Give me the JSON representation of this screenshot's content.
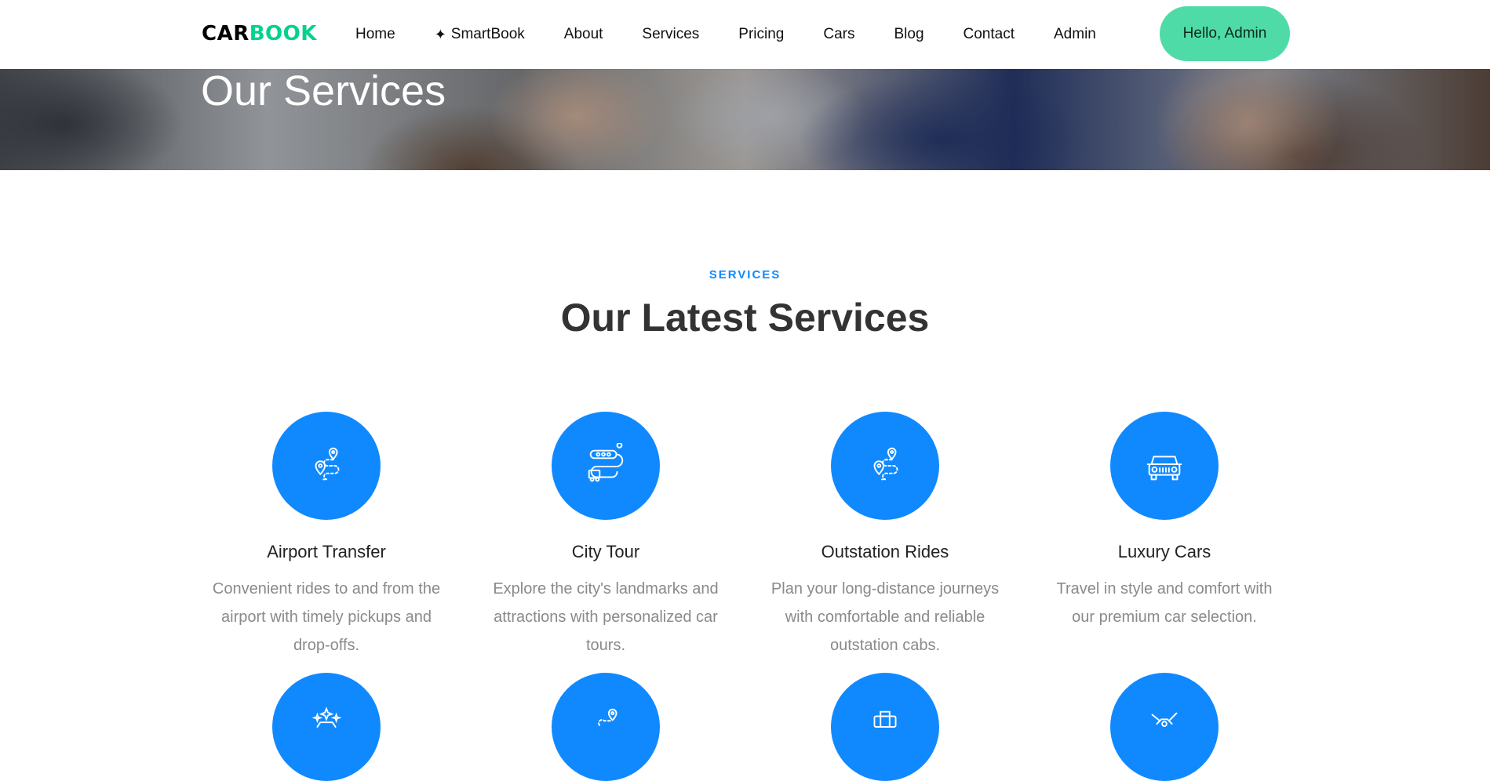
{
  "brand": {
    "part1": "CAR",
    "part2": "BOOK"
  },
  "nav": {
    "items": [
      {
        "label": "Home"
      },
      {
        "label": "SmartBook",
        "icon": "sparkle-icon"
      },
      {
        "label": "About"
      },
      {
        "label": "Services"
      },
      {
        "label": "Pricing"
      },
      {
        "label": "Cars"
      },
      {
        "label": "Blog"
      },
      {
        "label": "Contact"
      },
      {
        "label": "Admin"
      }
    ],
    "user_button": "Hello, Admin"
  },
  "hero": {
    "title": "Our Services"
  },
  "section": {
    "eyebrow": "SERVICES",
    "title": "Our Latest Services"
  },
  "services": [
    {
      "title": "Airport Transfer",
      "description": "Convenient rides to and from the airport with timely pickups and drop-offs.",
      "icon": "route-pin-icon"
    },
    {
      "title": "City Tour",
      "description": "Explore the city's landmarks and attractions with personalized car tours.",
      "icon": "city-tour-icon"
    },
    {
      "title": "Outstation Rides",
      "description": "Plan your long-distance journeys with comfortable and reliable outstation cabs.",
      "icon": "route-pin-icon"
    },
    {
      "title": "Luxury Cars",
      "description": "Travel in style and comfort with our premium car selection.",
      "icon": "jeep-icon"
    }
  ],
  "colors": {
    "accent": "#1089ff",
    "brand_green": "#01d28e",
    "button_green": "#4fdba7"
  }
}
